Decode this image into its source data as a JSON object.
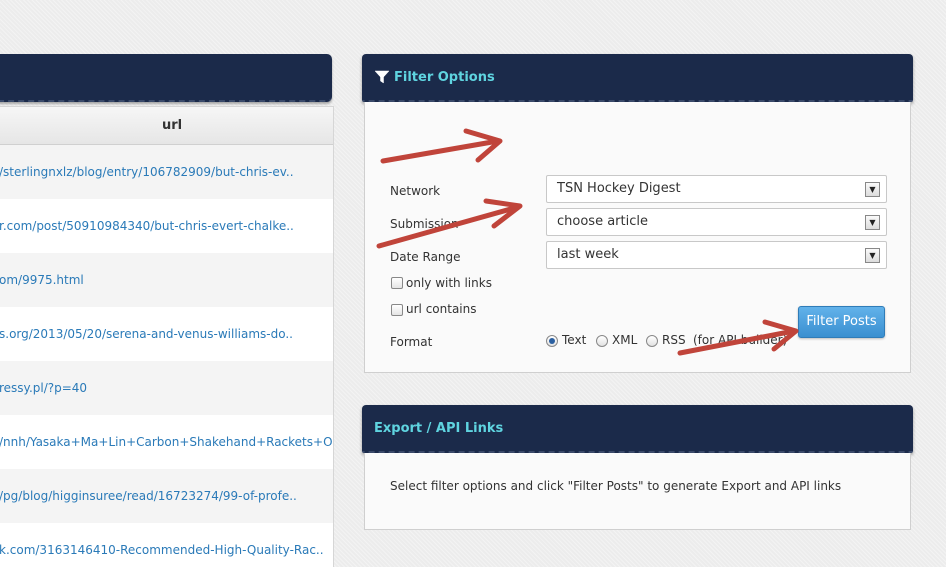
{
  "left_table": {
    "column_header": "url",
    "rows": [
      "/sterlingnxlz/blog/entry/106782909/but-chris-ev..",
      "r.com/post/50910984340/but-chris-evert-chalke..",
      "om/9975.html",
      "s.org/2013/05/20/serena-and-venus-williams-do..",
      "ressy.pl/?p=40",
      "/nnh/Yasaka+Ma+Lin+Carbon+Shakehand+Rackets+O..",
      "/pg/blog/higginsuree/read/16723274/99-of-profe..",
      "k.com/3163146410-Recommended-High-Quality-Rac.."
    ]
  },
  "filter_panel": {
    "title": "Filter Options",
    "network_label": "Network",
    "network_value": "TSN Hockey Digest",
    "submission_label": "Submission",
    "submission_value": "choose article",
    "date_range_label": "Date Range",
    "date_range_value": "last week",
    "only_links_label": "only with links",
    "url_contains_label": "url contains",
    "format_label": "Format",
    "format_options": [
      "Text",
      "XML",
      "RSS"
    ],
    "format_selected": "Text",
    "format_note": "(for API builder)",
    "submit_label": "Filter Posts"
  },
  "export_panel": {
    "title": "Export / API Links",
    "message": "Select filter options and click \"Filter Posts\" to generate Export and API links"
  },
  "colors": {
    "header_bg": "#1b2a4a",
    "header_text": "#5fd4e0",
    "link": "#2a7ab8",
    "button": "#3a8fd0",
    "annotation_arrow": "#c0443a"
  }
}
